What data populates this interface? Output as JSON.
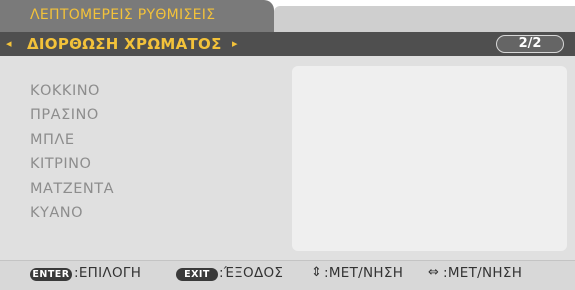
{
  "tab": {
    "label": "ΛΕΠΤΟΜΕΡΕΙΣ ΡΥΘΜΙΣΕΙΣ"
  },
  "submenu": {
    "title": "ΔΙΟΡΘΩΣΗ ΧΡΩΜΑΤΟΣ",
    "left_arrow": "◂",
    "right_arrow": "▸",
    "page_indicator": "2/2"
  },
  "items": [
    {
      "label": "ΚΟΚΚΙΝΟ"
    },
    {
      "label": "ΠΡΑΣΙΝΟ"
    },
    {
      "label": "ΜΠΛΕ"
    },
    {
      "label": "ΚΙΤΡΙΝΟ"
    },
    {
      "label": "ΜΑΤΖΕΝΤΑ"
    },
    {
      "label": "ΚΥΑΝΟ"
    }
  ],
  "footer": {
    "enter_key": "ENTER",
    "enter_text": ":ΕΠΙΛΟΓΗ",
    "exit_key": "EXIT",
    "exit_text": ":ΈΞΟΔΟΣ",
    "updown_icon": "⇕",
    "updown_text": ":ΜΕΤ/ΝΗΣΗ",
    "leftright_icon": "⇔",
    "leftright_text": ":ΜΕΤ/ΝΗΣΗ"
  },
  "colors": {
    "accent": "#f3c23a",
    "tab_bg": "#7a7a7a",
    "submenu_bg": "#4f4f4f",
    "panel_bg": "#e0e0e0",
    "item_text": "#8d8d8d"
  }
}
